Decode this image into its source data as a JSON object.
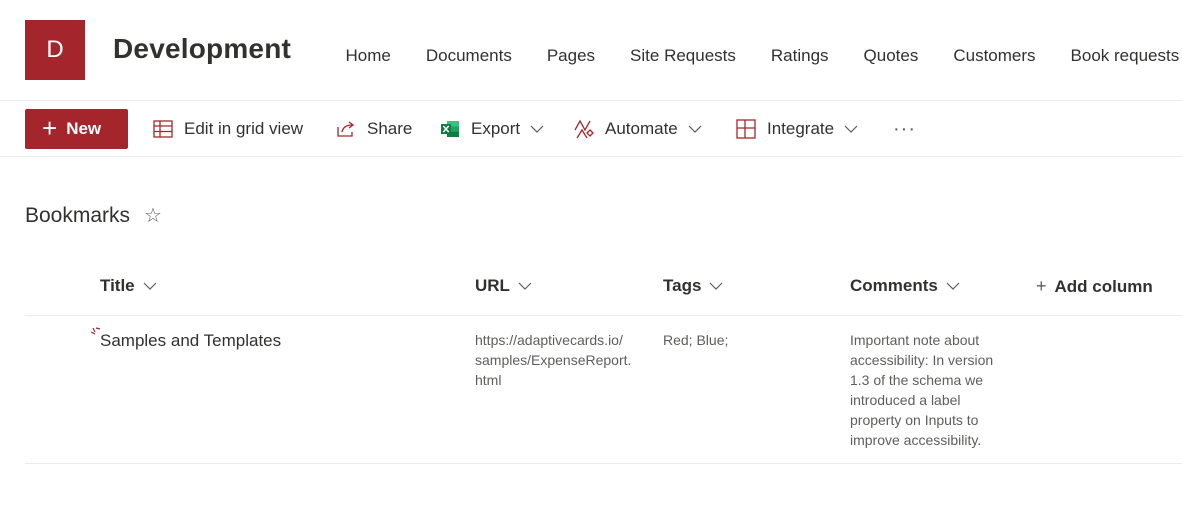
{
  "site": {
    "logo_letter": "D",
    "title": "Development",
    "brand_color": "#a4262c"
  },
  "nav": {
    "items": [
      "Home",
      "Documents",
      "Pages",
      "Site Requests",
      "Ratings",
      "Quotes",
      "Customers",
      "Book requests"
    ]
  },
  "command_bar": {
    "new_label": "New",
    "edit_grid_label": "Edit in grid view",
    "share_label": "Share",
    "export_label": "Export",
    "automate_label": "Automate",
    "integrate_label": "Integrate",
    "more_label": "···"
  },
  "list": {
    "title": "Bookmarks",
    "favorite_icon": "☆",
    "columns": {
      "title": "Title",
      "url": "URL",
      "tags": "Tags",
      "comments": "Comments",
      "add_column": "Add column"
    },
    "rows": [
      {
        "title": "Samples and Templates",
        "url_line1": "https://adaptivecards.io/",
        "url_line2": "samples/ExpenseReport.",
        "url_line3": "html",
        "tags": "Red; Blue;",
        "comments_lines": [
          "Important note about",
          "accessibility: In version",
          "1.3 of the schema we",
          "introduced a label",
          "property on Inputs to",
          "improve accessibility."
        ]
      }
    ]
  },
  "icons": {
    "plus": "plus-icon",
    "grid": "grid-icon",
    "share": "share-icon",
    "excel": "excel-icon",
    "automate": "automate-icon",
    "integrate": "integrate-icon",
    "chevron": "chevron-down-icon",
    "star": "star-icon"
  }
}
